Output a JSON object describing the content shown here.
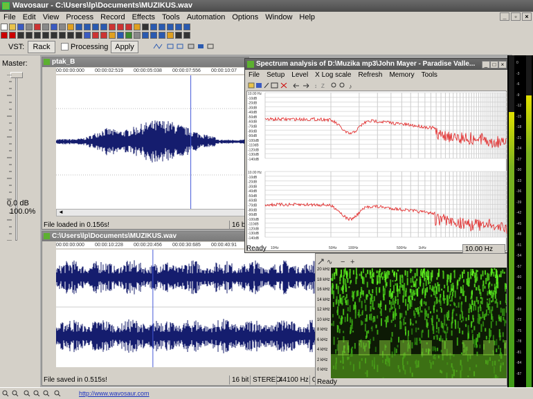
{
  "app": {
    "title": "Wavosaur - C:\\Users\\lp\\Documents\\MUZIKUS.wav",
    "window_buttons": [
      "_",
      "&#x25A1;",
      "X"
    ]
  },
  "menu": [
    "File",
    "Edit",
    "View",
    "Process",
    "Record",
    "Effects",
    "Tools",
    "Automation",
    "Options",
    "Window",
    "Help"
  ],
  "vst": {
    "label": "VST:",
    "rack": "Rack",
    "processing": "Processing",
    "apply": "Apply"
  },
  "master": {
    "label": "Master:",
    "db": "0.0 dB",
    "percent": "100.0%",
    "slider_level": 1.0
  },
  "windows": {
    "ptak": {
      "title": "ptak_B",
      "times": [
        "00:00:00:000",
        "00:00:02:519",
        "00:00:05:038",
        "00:00:07:556",
        "00:00:10:07"
      ],
      "status": "File loaded in 0.156s!",
      "bits": "16 bit"
    },
    "muzikus": {
      "title": "C:\\Users\\lp\\Documents\\MUZIKUS.wav",
      "times": [
        "00:00:00:000",
        "00:00:10:228",
        "00:00:20:456",
        "00:00:30:685",
        "00:00:40:91"
      ],
      "status": "File saved in 0.515s!",
      "bits": "16 bit",
      "channels": "STEREO",
      "rate": "44100 Hz",
      "extra": "0"
    },
    "spectrum": {
      "title": "Spectrum analysis of D:\\Muzika mp3\\John Mayer - Paradise Valle...",
      "menu": [
        "File",
        "Setup",
        "Level",
        "X Log scale",
        "Refresh",
        "Memory",
        "Tools"
      ],
      "db_labels": [
        "10.00 Hz",
        "-10dB",
        "-20dB",
        "-30dB",
        "-40dB",
        "-50dB",
        "-60dB",
        "-70dB",
        "-80dB",
        "-90dB",
        "-100dB",
        "-110dB",
        "-120dB",
        "-130dB",
        "-140dB"
      ],
      "freq_labels": [
        "10Hz",
        "50Hz",
        "100Hz",
        "500Hz",
        "1kHz",
        "5kHz",
        "10kHz"
      ],
      "status": "Ready",
      "freq_readout": "10.00 Hz"
    },
    "sonogram": {
      "freq_labels": [
        "20 kHz",
        "18 kHz",
        "16 kHz",
        "14 kHz",
        "12 kHz",
        "10 kHz",
        "8 kHz",
        "6 kHz",
        "4 kHz",
        "2 kHz",
        "0 kHz"
      ],
      "status": "Ready"
    }
  },
  "vu": {
    "labels": [
      "0",
      "-3",
      "-6",
      "-9",
      "-12",
      "-15",
      "-18",
      "-21",
      "-24",
      "-27",
      "-30",
      "-33",
      "-36",
      "-39",
      "-42",
      "-45",
      "-48",
      "-51",
      "-54",
      "-57",
      "-60",
      "-63",
      "-66",
      "-69",
      "-72",
      "-75",
      "-78",
      "-81",
      "-84",
      "-87"
    ],
    "left_level": 0.83,
    "right_level": 0.88
  },
  "footer": {
    "link": "http://www.wavosaur.com"
  }
}
